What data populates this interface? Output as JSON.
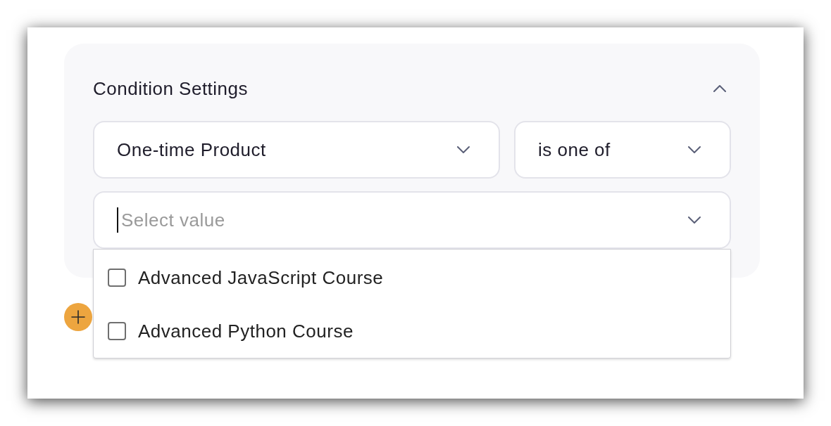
{
  "panel": {
    "title": "Condition Settings",
    "expanded": true
  },
  "condition": {
    "field": {
      "value": "One-time Product"
    },
    "operator": {
      "value": "is one of"
    },
    "value_field": {
      "placeholder": "Select value",
      "focused": true
    }
  },
  "dropdown": {
    "open": true,
    "options": [
      {
        "label": "Advanced JavaScript Course",
        "checked": false
      },
      {
        "label": "Advanced Python Course",
        "checked": false
      }
    ]
  }
}
